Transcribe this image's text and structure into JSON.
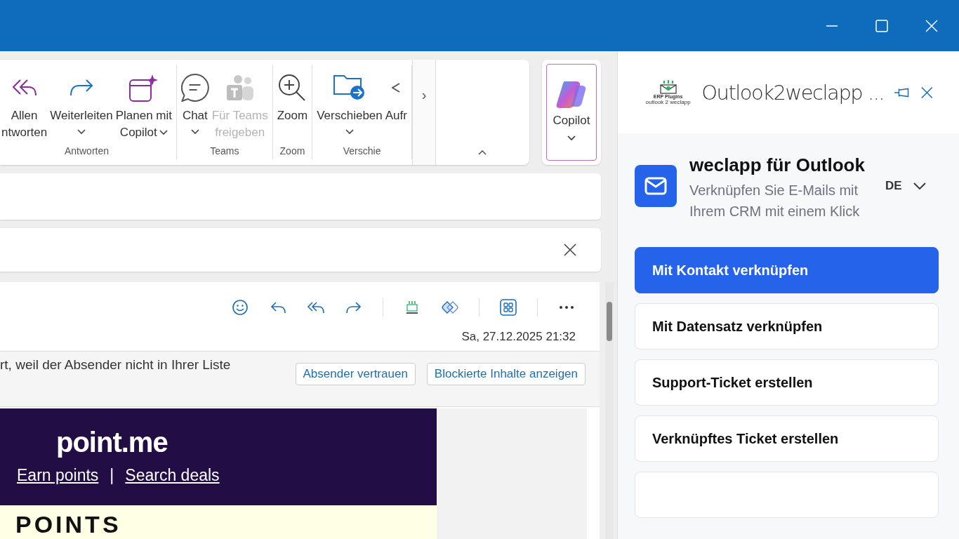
{
  "ribbon": {
    "groups": [
      {
        "name": "Antworten",
        "items": [
          {
            "kind": "reply-all",
            "lines": [
              "Allen",
              "ntworten"
            ],
            "dropdown": false,
            "disabled": false
          },
          {
            "kind": "forward",
            "lines": [
              "Weiterleiten"
            ],
            "dropdown": true,
            "disabled": false
          },
          {
            "kind": "calendar-sparkle",
            "lines": [
              "Planen mit",
              "Copilot"
            ],
            "dropdown": true,
            "disabled": false
          }
        ]
      },
      {
        "name": "Teams",
        "items": [
          {
            "kind": "chat",
            "lines": [
              "Chat"
            ],
            "dropdown": true,
            "disabled": false
          },
          {
            "kind": "teams",
            "lines": [
              "Für Teams",
              "freigeben"
            ],
            "dropdown": false,
            "disabled": true
          }
        ]
      },
      {
        "name": "Zoom",
        "items": [
          {
            "kind": "zoom",
            "lines": [
              "Zoom"
            ],
            "dropdown": false,
            "disabled": false
          }
        ]
      },
      {
        "name": "Verschie",
        "items": [
          {
            "kind": "folder-move",
            "lines": [
              "Verschieben"
            ],
            "dropdown": true,
            "disabled": false
          },
          {
            "kind": "partial",
            "lines": [
              "Aufr"
            ],
            "dropdown": false,
            "disabled": false
          }
        ]
      }
    ],
    "copilot": {
      "label": "Copilot",
      "dropdown": true
    },
    "scroll_right": "›"
  },
  "email": {
    "date": "Sa, 27.12.2025 21:32",
    "notice": "rt, weil der Absender nicht in Ihrer Liste",
    "notice_buttons": [
      "Absender vertrauen",
      "Blockierte Inhalte anzeigen"
    ],
    "body": {
      "logo": "point.me",
      "links": [
        "Earn points",
        "Search deals"
      ],
      "separator": "|",
      "headline": "POINTS"
    }
  },
  "addin": {
    "title": "Outlook2weclapp ...",
    "logo_lines": [
      "ERP Plugins",
      "outlook 2 weclapp"
    ],
    "heading": "weclapp für Outlook",
    "subtitle": "Verknüpfen Sie E-Mails mit Ihrem CRM mit einem Klick",
    "language": "DE",
    "actions": [
      {
        "label": "Mit Kontakt verknüpfen",
        "primary": true
      },
      {
        "label": "Mit Datensatz verknüpfen",
        "primary": false
      },
      {
        "label": "Support-Ticket erstellen",
        "primary": false
      },
      {
        "label": "Verknüpftes Ticket erstellen",
        "primary": false
      },
      {
        "primary": false
      }
    ]
  }
}
